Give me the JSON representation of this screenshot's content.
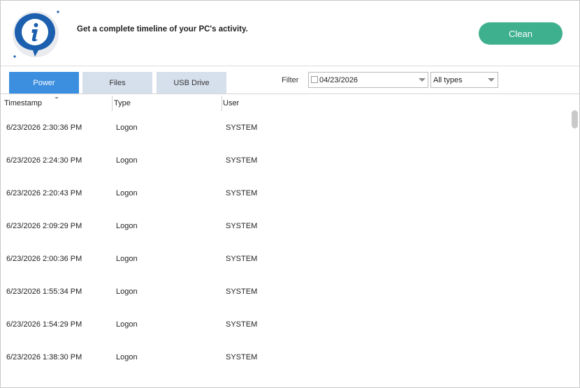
{
  "header": {
    "headline": "Get a complete timeline of your PC's activity.",
    "clean_label": "Clean"
  },
  "tabs": [
    {
      "label": "Power",
      "active": true
    },
    {
      "label": "Files",
      "active": false
    },
    {
      "label": "USB Drive",
      "active": false
    }
  ],
  "filter": {
    "label": "Filter",
    "date_value": "04/23/2026",
    "date_checked": false,
    "type_value": "All types"
  },
  "table": {
    "columns": [
      "Timestamp",
      "Type",
      "User"
    ],
    "rows": [
      {
        "timestamp": "6/23/2026 2:30:36 PM",
        "type": "Logon",
        "user": "SYSTEM"
      },
      {
        "timestamp": "6/23/2026 2:24:30 PM",
        "type": "Logon",
        "user": "SYSTEM"
      },
      {
        "timestamp": "6/23/2026 2:20:43 PM",
        "type": "Logon",
        "user": "SYSTEM"
      },
      {
        "timestamp": "6/23/2026 2:09:29 PM",
        "type": "Logon",
        "user": "SYSTEM"
      },
      {
        "timestamp": "6/23/2026 2:00:36 PM",
        "type": "Logon",
        "user": "SYSTEM"
      },
      {
        "timestamp": "6/23/2026 1:55:34 PM",
        "type": "Logon",
        "user": "SYSTEM"
      },
      {
        "timestamp": "6/23/2026 1:54:29 PM",
        "type": "Logon",
        "user": "SYSTEM"
      },
      {
        "timestamp": "6/23/2026 1:38:30 PM",
        "type": "Logon",
        "user": "SYSTEM"
      }
    ]
  },
  "colors": {
    "accent_active_tab": "#3c8fdf",
    "inactive_tab": "#d6e0ed",
    "clean_button": "#3fb08e",
    "logo_blue": "#1b5fae"
  },
  "icons": {
    "logo": "info-bubble-icon",
    "dropdown": "chevron-down-icon"
  }
}
